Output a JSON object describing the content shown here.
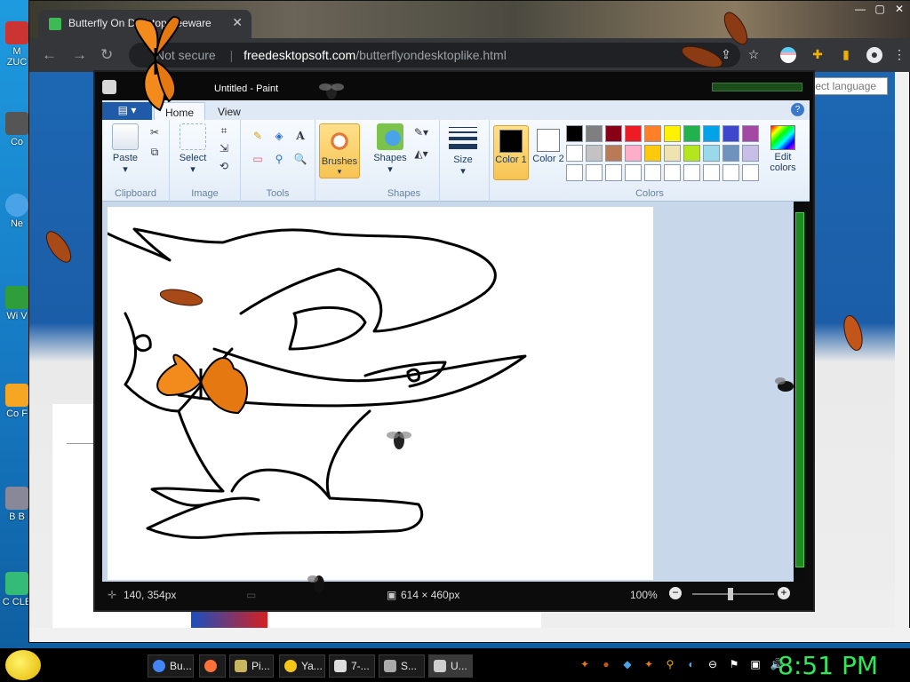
{
  "desktop": {
    "icons": [
      {
        "label": "M ZUC",
        "color": "#c33"
      },
      {
        "label": "Co",
        "color": "#555"
      },
      {
        "label": "Ne",
        "color": "#4aa3e6"
      },
      {
        "label": "Wi V",
        "color": "#2e9d3a"
      },
      {
        "label": "Co F",
        "color": "#f5a623"
      },
      {
        "label": "B B",
        "color": "#889"
      },
      {
        "label": "C CLE",
        "color": "#3b7"
      }
    ]
  },
  "browser": {
    "tab_title": "Butterfly On Desktop  freeware",
    "security_label": "Not secure",
    "url_host": "freedesktopsoft.com",
    "url_path": "/butterflyondesktoplike.html",
    "language_select": "Select language"
  },
  "paint": {
    "window_title": "Untitled - Paint",
    "tabs": {
      "home": "Home",
      "view": "View"
    },
    "groups": {
      "clipboard": "Clipboard",
      "image": "Image",
      "tools": "Tools",
      "shapes": "Shapes",
      "colors": "Colors"
    },
    "buttons": {
      "paste": "Paste",
      "select": "Select",
      "brushes": "Brushes",
      "shapes": "Shapes",
      "size": "Size",
      "color1": "Color 1",
      "color2": "Color 2",
      "edit_colors": "Edit colors"
    },
    "colors": {
      "color1": "#000000",
      "color2": "#ffffff",
      "palette": [
        "#000000",
        "#7f7f7f",
        "#880015",
        "#ed1c24",
        "#ff7f27",
        "#fff200",
        "#22b14c",
        "#00a2e8",
        "#3f48cc",
        "#a349a4",
        "#ffffff",
        "#c3c3c3",
        "#b97a57",
        "#ffaec9",
        "#ffc90e",
        "#efe4b0",
        "#b5e61d",
        "#99d9ea",
        "#7092be",
        "#c8bfe7",
        "#ffffff",
        "#ffffff",
        "#ffffff",
        "#ffffff",
        "#ffffff",
        "#ffffff",
        "#ffffff",
        "#ffffff",
        "#ffffff",
        "#ffffff"
      ]
    },
    "status": {
      "cursor_pos": "140, 354px",
      "canvas_size": "614 × 460px",
      "zoom": "100%"
    }
  },
  "taskbar": {
    "items": [
      {
        "label": "Bu...",
        "icon": "chrome-icon",
        "color": "#4285f4"
      },
      {
        "label": "",
        "icon": "firefox-icon",
        "color": "#ff7139"
      },
      {
        "label": "Pi...",
        "icon": "picture-icon",
        "color": "#c8b560"
      },
      {
        "label": "Ya...",
        "icon": "yahoo-icon",
        "color": "#f5c518"
      },
      {
        "label": "7-...",
        "icon": "7zip-icon",
        "color": "#ddd"
      },
      {
        "label": "S...",
        "icon": "setup-icon",
        "color": "#aaa"
      },
      {
        "label": "U...",
        "icon": "paint-icon",
        "color": "#cfcfcf"
      }
    ],
    "clock": "8:51 PM"
  }
}
